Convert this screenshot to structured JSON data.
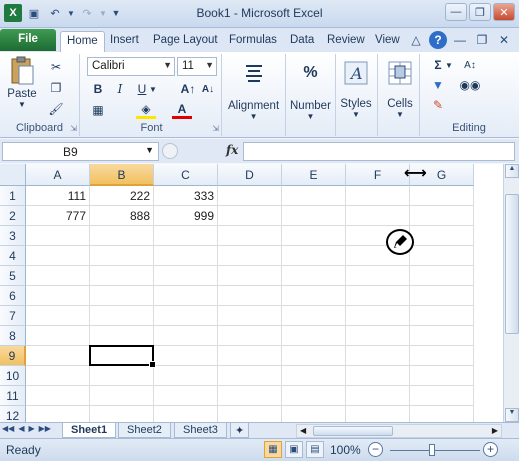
{
  "window": {
    "title": "Book1 - Microsoft Excel"
  },
  "tabs": [
    "File",
    "Home",
    "Insert",
    "Page Layout",
    "Formulas",
    "Data",
    "Review",
    "View"
  ],
  "ribbon": {
    "clipboard": {
      "paste_label": "Paste",
      "group_label": "Clipboard"
    },
    "font": {
      "font_name": "Calibri",
      "font_size": "11",
      "group_label": "Font",
      "bold": "B",
      "italic": "I",
      "underline": "U"
    },
    "alignment_label": "Alignment",
    "number_label": "Number",
    "number_icon": "%",
    "styles_label": "Styles",
    "cells_label": "Cells",
    "editing_label": "Editing"
  },
  "formula_bar": {
    "name_box": "B9",
    "fx": "fx",
    "formula": ""
  },
  "columns": [
    "A",
    "B",
    "C",
    "D",
    "E",
    "F",
    "G"
  ],
  "rows": [
    "1",
    "2",
    "3",
    "4",
    "5",
    "6",
    "7",
    "8",
    "9",
    "10",
    "11",
    "12"
  ],
  "cells": {
    "A1": "111",
    "B1": "222",
    "C1": "333",
    "A2": "777",
    "B2": "888",
    "C2": "999"
  },
  "selection": {
    "column": "B",
    "row": "9"
  },
  "sheets": [
    "Sheet1",
    "Sheet2",
    "Sheet3"
  ],
  "active_sheet": "Sheet1",
  "status": {
    "ready": "Ready",
    "zoom": "100%",
    "zoom_minus": "−",
    "zoom_plus": "+"
  },
  "colors": {
    "file_tab": "#1d6b32",
    "selection_header": "#f1c15f",
    "grid_line": "#dadcdd"
  }
}
